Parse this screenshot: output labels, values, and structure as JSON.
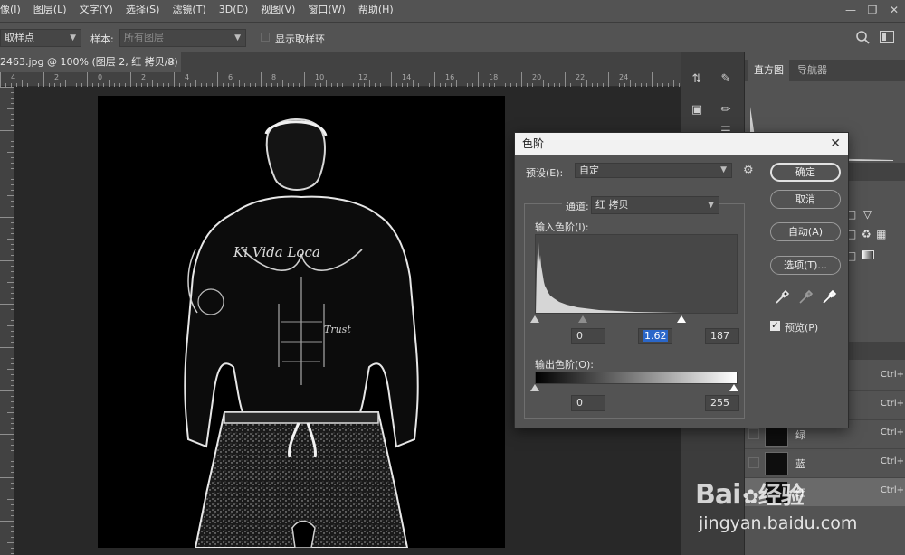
{
  "menus": [
    "像(I)",
    "图层(L)",
    "文字(Y)",
    "选择(S)",
    "滤镜(T)",
    "3D(D)",
    "视图(V)",
    "窗口(W)",
    "帮助(H)"
  ],
  "options": {
    "sample_point": "取样点",
    "sample_label": "样本:",
    "sample_value": "所有图层",
    "show_ring": "显示取样环"
  },
  "document": {
    "tab_title": "2463.jpg @ 100% (图层 2, 红 拷贝/8) *",
    "close": "×",
    "ruler_labels": [
      "4",
      "2",
      "0",
      "2",
      "4",
      "6",
      "8",
      "10",
      "12",
      "14",
      "16",
      "18",
      "20",
      "22",
      "24"
    ]
  },
  "panel": {
    "tabs": [
      "直方图",
      "导航器"
    ],
    "channels": [
      {
        "name": "",
        "shortcut": "Ctrl+"
      },
      {
        "name": "",
        "shortcut": "Ctrl+"
      },
      {
        "name": "绿",
        "shortcut": "Ctrl+"
      },
      {
        "name": "蓝",
        "shortcut": "Ctrl+"
      },
      {
        "name": "红",
        "shortcut": "Ctrl+"
      }
    ]
  },
  "dialog": {
    "title": "色阶",
    "close": "✕",
    "preset_label": "预设(E):",
    "preset_value": "自定",
    "channel_label": "通道:",
    "channel_value": "红 拷贝",
    "input_label": "输入色阶(I):",
    "input_black": "0",
    "input_gamma": "1.62",
    "input_white": "187",
    "output_label": "输出色阶(O):",
    "output_black": "0",
    "output_white": "255",
    "buttons": {
      "ok": "确定",
      "cancel": "取消",
      "auto": "自动(A)",
      "options": "选项(T)..."
    },
    "preview_label": "预览(P)",
    "preview_checked": true
  },
  "watermark": {
    "logo": "Bai",
    "logo_cn": "经验",
    "url": "jingyan.baidu.com"
  }
}
